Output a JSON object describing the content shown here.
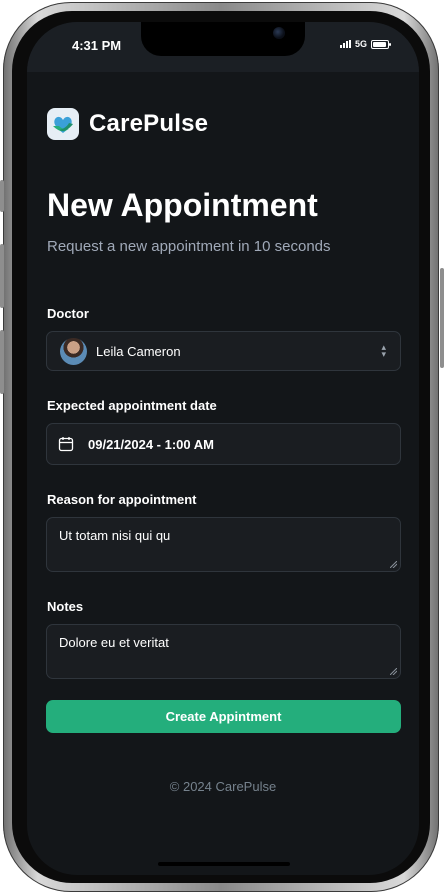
{
  "status_bar": {
    "time": "4:31 PM",
    "network": "5G",
    "icons": [
      "signal-icon",
      "battery-icon"
    ]
  },
  "brand": {
    "name": "CarePulse",
    "logo_icon": "heart-hands-logo"
  },
  "header": {
    "title": "New Appointment",
    "subtitle": "Request a new appointment in 10 seconds"
  },
  "form": {
    "doctor": {
      "label": "Doctor",
      "value": "Leila Cameron",
      "icon": "chevron-updown-icon"
    },
    "date": {
      "label": "Expected appointment date",
      "value": "09/21/2024 - 1:00 AM",
      "icon": "calendar-icon"
    },
    "reason": {
      "label": "Reason for appointment",
      "value": "Ut totam nisi qui qu"
    },
    "notes": {
      "label": "Notes",
      "value": "Dolore eu et veritat"
    },
    "submit_label": "Create Appintment"
  },
  "footer": {
    "copyright": "© 2024 CarePulse"
  },
  "colors": {
    "background": "#131619",
    "field_background": "#1a1d21",
    "field_border": "#2f353c",
    "accent": "#24ae7c",
    "subtitle": "#a0a9b8"
  }
}
